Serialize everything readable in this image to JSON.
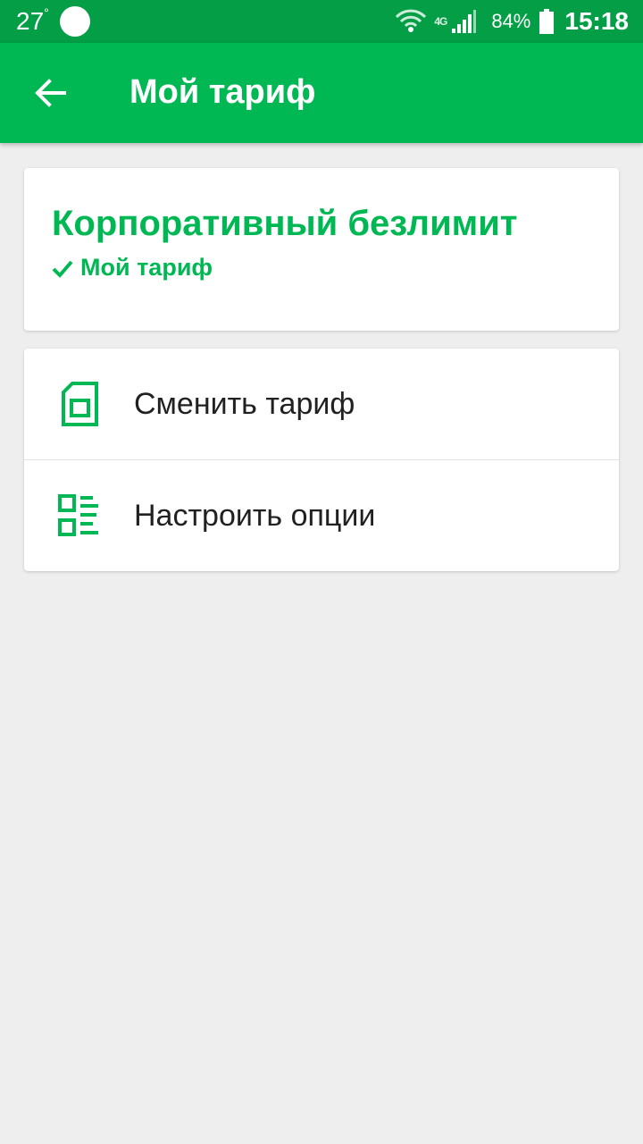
{
  "status_bar": {
    "temperature": "27",
    "degree": "°",
    "network_type": "4G",
    "battery_percent": "84%",
    "time": "15:18"
  },
  "app_bar": {
    "title": "Мой тариф",
    "back_icon": "arrow-left-icon"
  },
  "tariff": {
    "name": "Корпоративный безлимит",
    "badge_label": "Мой тариф",
    "badge_icon": "checkmark-icon"
  },
  "actions": [
    {
      "label": "Сменить тариф",
      "icon": "sim-card-icon"
    },
    {
      "label": "Настроить опции",
      "icon": "options-list-icon"
    }
  ],
  "colors": {
    "primary": "#00b853",
    "status_bar": "#039e46",
    "background": "#eeeeee",
    "text_dark": "#212121"
  }
}
